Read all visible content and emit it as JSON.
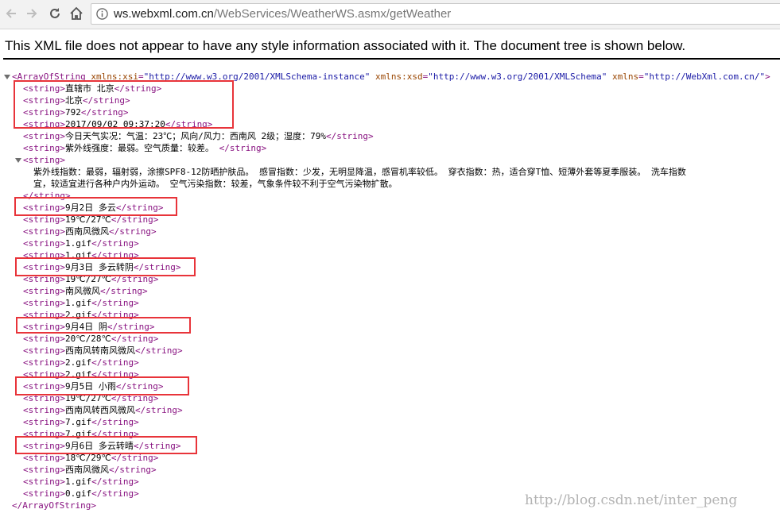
{
  "browser": {
    "url_host": "ws.webxml.com.cn",
    "url_path": "/WebServices/WeatherWS.asmx/getWeather"
  },
  "notice": "This XML file does not appear to have any style information associated with it. The document tree is shown below.",
  "xml": {
    "root_open": "<ArrayOfString",
    "attrs": [
      {
        "name": " xmlns:xsi",
        "value": "\"http://www.w3.org/2001/XMLSchema-instance\""
      },
      {
        "name": " xmlns:xsd",
        "value": "\"http://www.w3.org/2001/XMLSchema\""
      },
      {
        "name": " xmlns",
        "value": "\"http://WebXml.com.cn/\""
      }
    ],
    "open_close": ">",
    "open_tag": "<string>",
    "close_tag": "</string>",
    "root_close": "</ArrayOfString>",
    "strings": [
      "直辖市 北京",
      "北京",
      "792",
      "2017/09/02 09:37:20",
      "今日天气实况：气温：23℃；风向/风力：西南风 2级；湿度：79%",
      "紫外线强度：最弱。空气质量：较差。 "
    ],
    "multiline": [
      "紫外线指数：最弱，辐射弱，涂擦SPF8-12防晒护肤品。 感冒指数：少发，无明显降温，感冒机率较低。 穿衣指数：热，适合穿T恤、短薄外套等夏季服装。 洗车指数",
      "宜，较适宜进行各种户内外运动。 空气污染指数：较差，气象条件较不利于空气污染物扩散。"
    ],
    "days": [
      [
        "9月2日 多云",
        "19℃/27℃",
        "西南风微风",
        "1.gif",
        "1.gif"
      ],
      [
        "9月3日 多云转阴",
        "19℃/27℃",
        "南风微风",
        "1.gif",
        "2.gif"
      ],
      [
        "9月4日 阴",
        "20℃/28℃",
        "西南风转南风微风",
        "2.gif",
        "2.gif"
      ],
      [
        "9月5日 小雨",
        "19℃/27℃",
        "西南风转西风微风",
        "7.gif",
        "7.gif"
      ],
      [
        "9月6日 多云转晴",
        "18℃/29℃",
        "西南风微风",
        "1.gif",
        "0.gif"
      ]
    ]
  },
  "watermark": "http://blog.csdn.net/inter_peng",
  "colors": {
    "tag": "#881280",
    "attr_name": "#994500",
    "attr_value": "#1a1aa6",
    "highlight": "#e8343a"
  }
}
